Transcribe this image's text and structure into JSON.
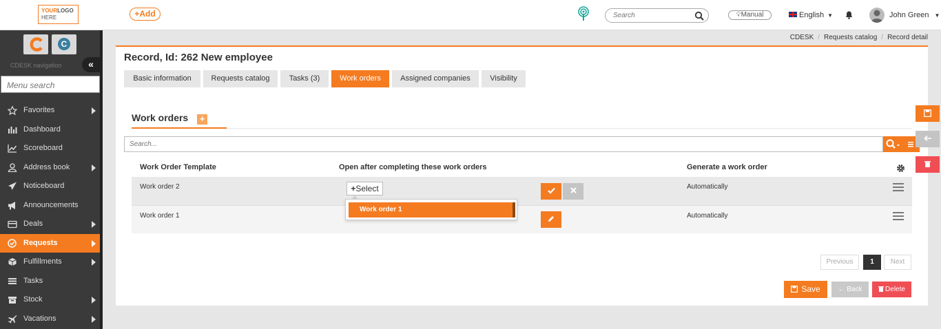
{
  "header": {
    "logo_line1a": "YOUR",
    "logo_line1b": "LOGO",
    "logo_line2": "HERE",
    "add_label": "+Add",
    "search_placeholder": "Search",
    "manual_label": "Manual",
    "language": "English",
    "user_name": "John Green"
  },
  "sidebar": {
    "nav_label": "CDESK navigation",
    "collapse_symbol": "«",
    "menu_search_placeholder": "Menu search",
    "items": [
      {
        "label": "Favorites",
        "icon": "star-icon",
        "has_arrow": true
      },
      {
        "label": "Dashboard",
        "icon": "bar-chart-icon",
        "has_arrow": false
      },
      {
        "label": "Scoreboard",
        "icon": "line-chart-icon",
        "has_arrow": false
      },
      {
        "label": "Address book",
        "icon": "user-icon",
        "has_arrow": true
      },
      {
        "label": "Noticeboard",
        "icon": "paper-plane-icon",
        "has_arrow": false
      },
      {
        "label": "Announcements",
        "icon": "bullhorn-icon",
        "has_arrow": false
      },
      {
        "label": "Deals",
        "icon": "wallet-icon",
        "has_arrow": true
      },
      {
        "label": "Requests",
        "icon": "check-circle-icon",
        "has_arrow": true,
        "active": true
      },
      {
        "label": "Fulfillments",
        "icon": "cube-icon",
        "has_arrow": true
      },
      {
        "label": "Tasks",
        "icon": "list-icon",
        "has_arrow": false
      },
      {
        "label": "Stock",
        "icon": "box-icon",
        "has_arrow": true
      },
      {
        "label": "Vacations",
        "icon": "plane-icon",
        "has_arrow": true
      }
    ]
  },
  "breadcrumb": [
    "CDESK",
    "Requests catalog",
    "Record detail"
  ],
  "page": {
    "title": "Record, Id: 262 New employee",
    "tabs": [
      {
        "label": "Basic information",
        "active": false
      },
      {
        "label": "Requests catalog",
        "active": false
      },
      {
        "label": "Tasks (3)",
        "active": false
      },
      {
        "label": "Work orders",
        "active": true
      },
      {
        "label": "Assigned companies",
        "active": false
      },
      {
        "label": "Visibility",
        "active": false
      }
    ],
    "section_title": "Work orders",
    "section_add": "+",
    "table_search_placeholder": "Search...",
    "columns": [
      "Work Order Template",
      "Open after completing these work orders",
      "Generate a work order"
    ],
    "rows": [
      {
        "template": "Work order 2",
        "generate": "Automatically"
      },
      {
        "template": "Work order 1",
        "generate": "Automatically"
      }
    ],
    "select_label": "Select",
    "dropdown_option": "Work order 1",
    "pagination": {
      "previous": "Previous",
      "current": "1",
      "next": "Next"
    },
    "buttons": {
      "save": "Save",
      "back": "Back",
      "delete": "Delete"
    }
  },
  "colors": {
    "accent": "#f47b20",
    "danger": "#f04e55",
    "sidebar": "#3a3a3a",
    "teal": "#17a89a"
  }
}
